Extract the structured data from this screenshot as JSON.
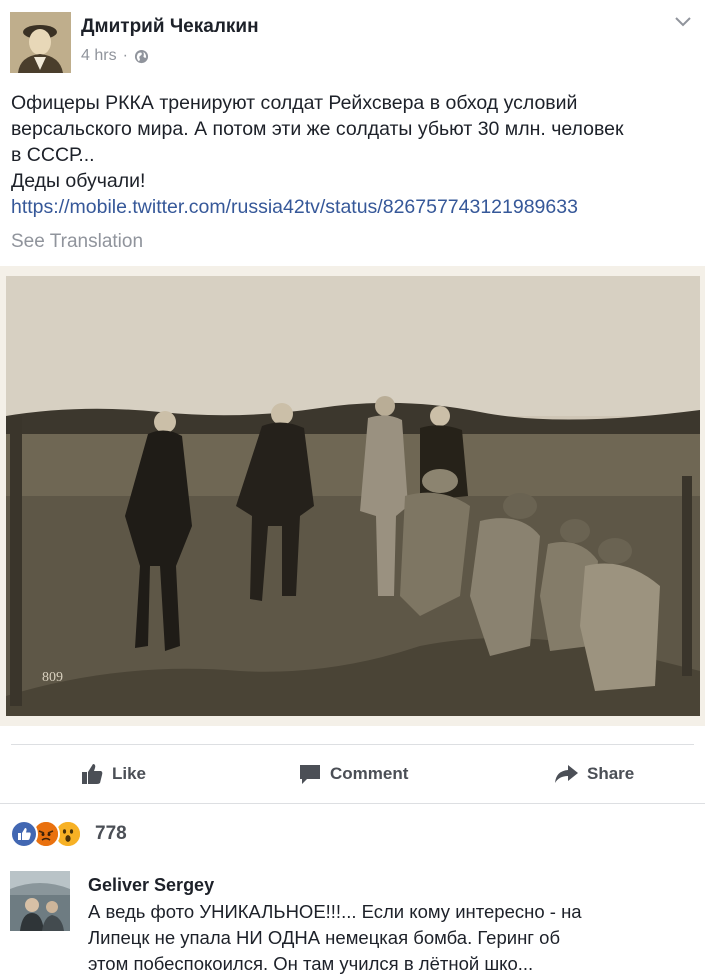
{
  "post": {
    "author": "Дмитрий Чекалкин",
    "time": "4 hrs",
    "separator": "·",
    "privacy_icon": "globe-icon",
    "text_lines": [
      "Офицеры РККА тренируют солдат Рейхсвера в обход условий",
      "версальского мира. А потом эти же солдаты убьют 30 млн. человек",
      "в СССР...",
      "Деды обучали!"
    ],
    "link": "https://mobile.twitter.com/russia42tv/status/826757743121989633",
    "see_translation": "See Translation",
    "photo_caption": "809"
  },
  "actions": {
    "like": "Like",
    "comment": "Comment",
    "share": "Share"
  },
  "reactions": {
    "icons": [
      "like-reaction-icon",
      "angry-reaction-icon",
      "wow-reaction-icon"
    ],
    "count": "778"
  },
  "comment": {
    "author": "Geliver  Sergey",
    "text_lines": [
      "А ведь фото УНИКАЛЬНОЕ!!!... Если кому интересно - на",
      "Липецк не упала НИ ОДНА немецкая бомба. Геринг об",
      "этом побеспокоился. Он там учился в лётной шко..."
    ]
  },
  "colors": {
    "link": "#365899",
    "muted": "#90949c",
    "action": "#4b4f56",
    "like_blue": "#4267b2",
    "angry_red": "#e9710f",
    "wow_yellow": "#f7b125"
  }
}
